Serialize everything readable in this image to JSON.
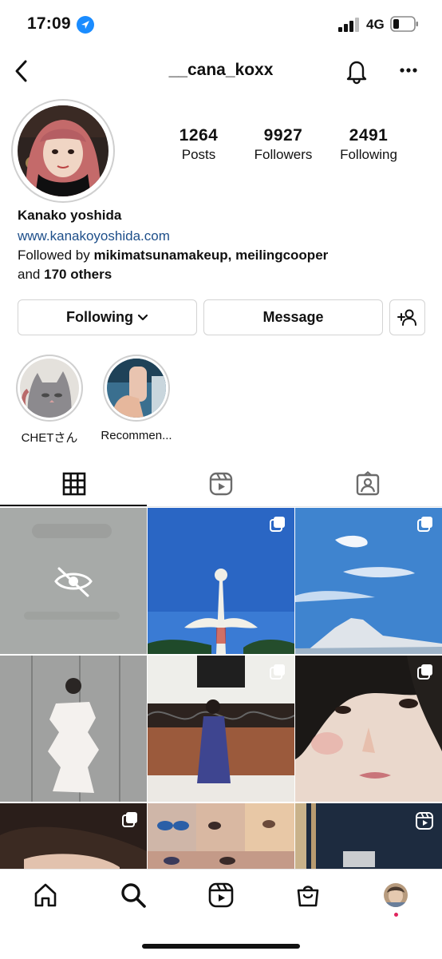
{
  "status_bar": {
    "time": "17:09",
    "network": "4G"
  },
  "header": {
    "username": "__cana_koxx"
  },
  "stats": [
    {
      "value": "1264",
      "label": "Posts"
    },
    {
      "value": "9927",
      "label": "Followers"
    },
    {
      "value": "2491",
      "label": "Following"
    }
  ],
  "bio": {
    "name": "Kanako yoshida",
    "link": "www.kanakoyoshida.com",
    "followed_prefix": "Followed by",
    "followed_users": "mikimatsunamakeup, meilingcooper",
    "and": "and",
    "others": "170 others"
  },
  "buttons": {
    "following": "Following",
    "message": "Message"
  },
  "highlights": [
    {
      "label": "CHETさん"
    },
    {
      "label": "Recommen..."
    }
  ],
  "colors": {
    "link": "#1e4f8a",
    "location_icon": "#1a8cff",
    "notification_dot": "#e0245e"
  }
}
